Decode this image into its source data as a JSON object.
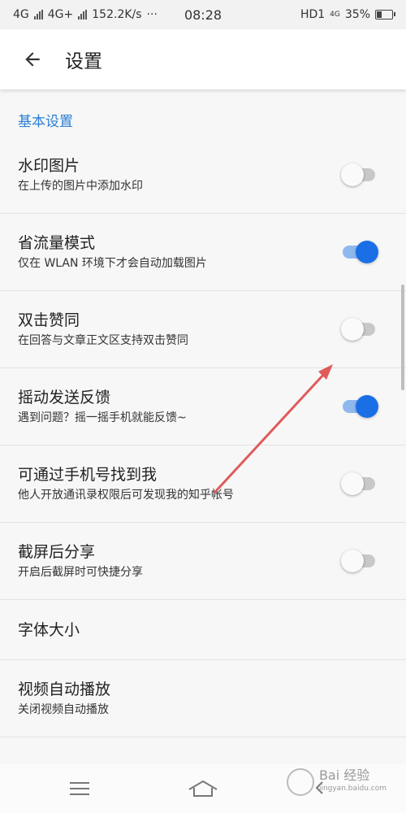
{
  "status_bar": {
    "net1": "4G",
    "net2": "4G+",
    "speed": "152.2K/s",
    "more": "···",
    "time": "08:28",
    "hd": "HD1",
    "net_small": "4G",
    "battery": "35%",
    "battery_level": 0.35
  },
  "app_bar": {
    "title": "设置",
    "back_icon": "arrow-left-icon"
  },
  "section": {
    "header": "基本设置"
  },
  "settings": [
    {
      "title": "水印图片",
      "subtitle": "在上传的图片中添加水印",
      "toggle": false
    },
    {
      "title": "省流量模式",
      "subtitle": "仅在 WLAN 环境下才会自动加载图片",
      "toggle": true
    },
    {
      "title": "双击赞同",
      "subtitle": "在回答与文章正文区支持双击赞同",
      "toggle": false
    },
    {
      "title": "摇动发送反馈",
      "subtitle": "遇到问题？摇一摇手机就能反馈~",
      "toggle": true
    },
    {
      "title": "可通过手机号找到我",
      "subtitle": "他人开放通讯录权限后可发现我的知乎帐号",
      "toggle": false
    },
    {
      "title": "截屏后分享",
      "subtitle": "开启后截屏时可快捷分享",
      "toggle": false
    },
    {
      "title": "字体大小"
    },
    {
      "title": "视频自动播放",
      "subtitle": "关闭视频自动播放"
    }
  ],
  "nav_bar": {
    "menu_icon": "menu-icon",
    "home_icon": "home-icon",
    "back_icon": "back-icon"
  },
  "watermark": {
    "text": "Bai 经验",
    "site": "jingyan.baidu.com"
  },
  "colors": {
    "accent": "#1a6fe6",
    "section_header": "#2a7fd4",
    "annotation_arrow": "#e05a5a"
  }
}
